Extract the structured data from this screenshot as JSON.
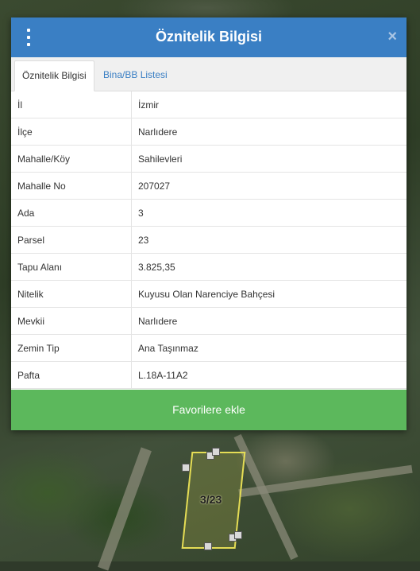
{
  "map": {
    "parcel_label": "3/23"
  },
  "modal": {
    "title": "Öznitelik Bilgisi",
    "close_glyph": "×",
    "tabs": [
      {
        "label": "Öznitelik Bilgisi",
        "active": true
      },
      {
        "label": "Bina/BB Listesi",
        "active": false
      }
    ],
    "rows": [
      {
        "key": "İl",
        "value": "İzmir"
      },
      {
        "key": "İlçe",
        "value": "Narlıdere"
      },
      {
        "key": "Mahalle/Köy",
        "value": "Sahilevleri"
      },
      {
        "key": "Mahalle No",
        "value": "207027"
      },
      {
        "key": "Ada",
        "value": "3"
      },
      {
        "key": "Parsel",
        "value": "23"
      },
      {
        "key": "Tapu Alanı",
        "value": "3.825,35"
      },
      {
        "key": "Nitelik",
        "value": "Kuyusu Olan Narenciye Bahçesi"
      },
      {
        "key": "Mevkii",
        "value": "Narlıdere"
      },
      {
        "key": "Zemin Tip",
        "value": "Ana Taşınmaz"
      },
      {
        "key": "Pafta",
        "value": "L.18A-11A2"
      }
    ],
    "favorite_button": "Favorilere ekle"
  },
  "colors": {
    "header": "#3a7fc4",
    "button": "#5cb85c",
    "parcel_outline": "#e5dd55"
  },
  "icons": {
    "menu": "vertical-dots-icon",
    "close": "close-icon"
  }
}
